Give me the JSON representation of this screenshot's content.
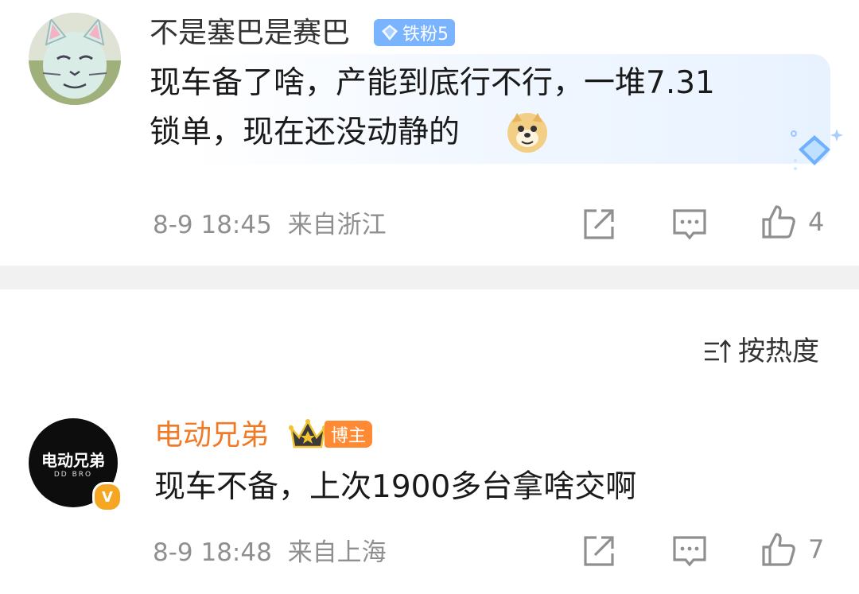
{
  "comments": [
    {
      "username": "不是塞巴是赛巴",
      "badge": "铁粉5",
      "text_line1": "现车备了啥，产能到底行不行，一堆7.31",
      "text_line2": "锁单，现在还没动静的",
      "emoji": "doge-emoji",
      "time": "8-9 18:45",
      "location": "来自浙江",
      "like_count": "4",
      "colors": {
        "username": "#333333",
        "badge_bg": "#7ab4ff"
      }
    },
    {
      "username": "电动兄弟",
      "badge": "博主",
      "avatar_text_cn": "电动兄弟",
      "avatar_text_en": "DD BRO",
      "verified": "V",
      "text": "现车不备，上次1900多台拿啥交啊",
      "time": "8-9 18:48",
      "location": "来自上海",
      "like_count": "7",
      "colors": {
        "username": "#f07a26",
        "badge_bg": "#ff8a33"
      }
    }
  ],
  "sort": {
    "label": "按热度",
    "icon": "sort-icon"
  },
  "colors": {
    "divider": "#f1f1f1",
    "meta_text": "#8f8f8f",
    "icon_gray": "#8f8f8f"
  }
}
